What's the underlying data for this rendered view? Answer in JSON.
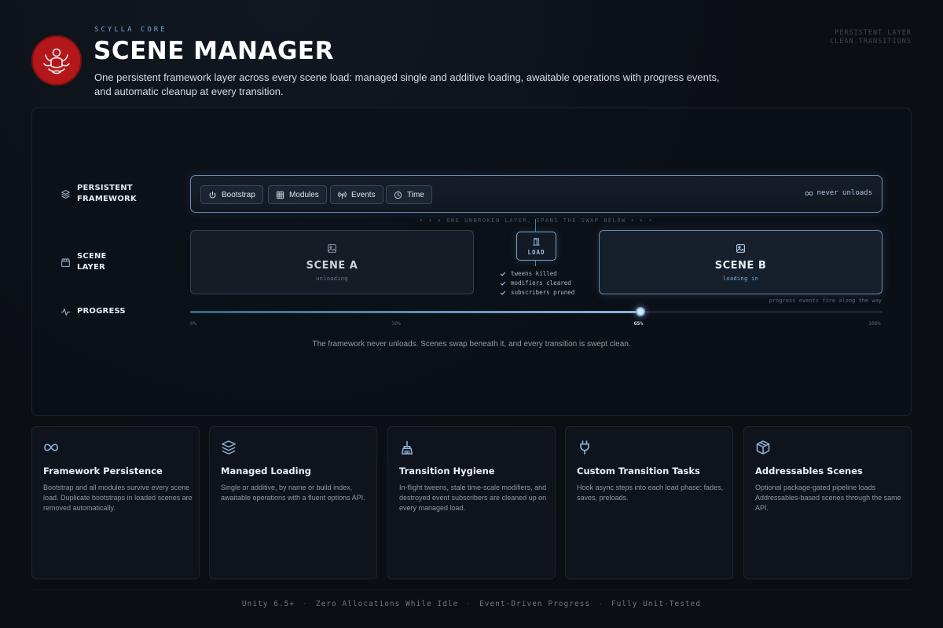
{
  "header": {
    "eyebrow": "SCYLLA CORE",
    "title": "SCENE MANAGER",
    "subtitle": "One persistent framework layer across every scene load: managed single and additive loading, awaitable operations with progress events, and automatic cleanup at every transition.",
    "top_right": [
      "PERSISTENT LAYER",
      "CLEAN TRANSITIONS"
    ],
    "logo_icon": "scylla-crest-icon"
  },
  "colors": {
    "accent": "#6fa3d9",
    "logo_red": "#b3171a",
    "background": "#0b0f14"
  },
  "diagram": {
    "rows": {
      "framework": "PERSISTENT FRAMEWORK",
      "scene": "SCENE LAYER",
      "progress": "PROGRESS"
    },
    "framework": {
      "chips": [
        {
          "label": "Bootstrap",
          "icon": "power-icon"
        },
        {
          "label": "Modules",
          "icon": "grid-icon"
        },
        {
          "label": "Events",
          "icon": "broadcast-icon"
        },
        {
          "label": "Time",
          "icon": "clock-icon"
        }
      ],
      "never_unloads": "never unloads"
    },
    "spans_caption": "• • •   ONE UNBROKEN LAYER, SPANS THE SWAP BELOW   • • •",
    "scene_a": {
      "name": "SCENE A",
      "status": "unloading"
    },
    "scene_b": {
      "name": "SCENE B",
      "status": "loading in"
    },
    "load": {
      "label": "LOAD",
      "checks": [
        "tweens killed",
        "modifiers cleared",
        "subscribers pruned"
      ]
    },
    "progress": {
      "note": "progress events fire along the way",
      "value": 0.65,
      "ticks": [
        {
          "label": "0%",
          "value": 0
        },
        {
          "label": "30%",
          "value": 0.3
        },
        {
          "label": "65%",
          "value": 0.65
        },
        {
          "label": "100%",
          "value": 1
        }
      ]
    },
    "tagline": "The framework never unloads. Scenes swap beneath it, and every transition is swept clean."
  },
  "cards": [
    {
      "icon": "infinity-icon",
      "title": "Framework Persistence",
      "desc": "Bootstrap and all modules survive every scene load. Duplicate bootstraps in loaded scenes are removed automatically."
    },
    {
      "icon": "layers-icon",
      "title": "Managed Loading",
      "desc": "Single or additive, by name or build index, awaitable operations with a fluent options API."
    },
    {
      "icon": "broom-icon",
      "title": "Transition Hygiene",
      "desc": "In-flight tweens, stale time-scale modifiers, and destroyed event subscribers are cleaned up on every managed load."
    },
    {
      "icon": "plug-icon",
      "title": "Custom Transition Tasks",
      "desc": "Hook async steps into each load phase: fades, saves, preloads."
    },
    {
      "icon": "package-icon",
      "title": "Addressables Scenes",
      "desc": "Optional package-gated pipeline loads Addressables-based scenes through the same API."
    }
  ],
  "footer": [
    "Unity 6.5+",
    "Zero Allocations While Idle",
    "Event-Driven Progress",
    "Fully Unit-Tested"
  ]
}
